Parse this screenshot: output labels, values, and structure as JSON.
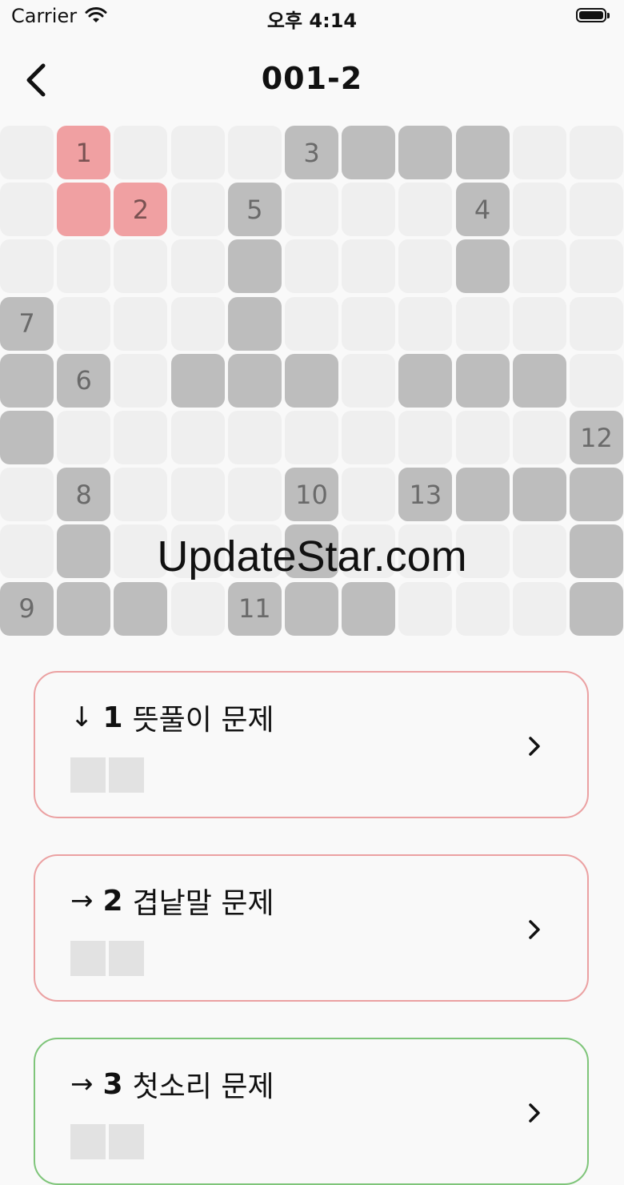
{
  "status_bar": {
    "carrier": "Carrier",
    "time": "오후 4:14"
  },
  "nav": {
    "title": "001-2"
  },
  "grid": {
    "cells": [
      {
        "r": 0,
        "c": 1,
        "state": "selected",
        "label": "1"
      },
      {
        "r": 0,
        "c": 5,
        "state": "filled",
        "label": "3"
      },
      {
        "r": 0,
        "c": 6,
        "state": "filled",
        "label": ""
      },
      {
        "r": 0,
        "c": 7,
        "state": "filled",
        "label": ""
      },
      {
        "r": 0,
        "c": 8,
        "state": "filled",
        "label": ""
      },
      {
        "r": 1,
        "c": 1,
        "state": "selected",
        "label": ""
      },
      {
        "r": 1,
        "c": 2,
        "state": "selected",
        "label": "2"
      },
      {
        "r": 1,
        "c": 4,
        "state": "filled",
        "label": "5"
      },
      {
        "r": 1,
        "c": 8,
        "state": "filled",
        "label": "4"
      },
      {
        "r": 2,
        "c": 4,
        "state": "filled",
        "label": ""
      },
      {
        "r": 2,
        "c": 8,
        "state": "filled",
        "label": ""
      },
      {
        "r": 3,
        "c": 0,
        "state": "filled",
        "label": "7"
      },
      {
        "r": 3,
        "c": 4,
        "state": "filled",
        "label": ""
      },
      {
        "r": 4,
        "c": 0,
        "state": "filled",
        "label": ""
      },
      {
        "r": 4,
        "c": 1,
        "state": "filled",
        "label": "6"
      },
      {
        "r": 4,
        "c": 3,
        "state": "filled",
        "label": ""
      },
      {
        "r": 4,
        "c": 4,
        "state": "filled",
        "label": ""
      },
      {
        "r": 4,
        "c": 5,
        "state": "filled",
        "label": ""
      },
      {
        "r": 4,
        "c": 7,
        "state": "filled",
        "label": ""
      },
      {
        "r": 4,
        "c": 8,
        "state": "filled",
        "label": ""
      },
      {
        "r": 4,
        "c": 9,
        "state": "filled",
        "label": ""
      },
      {
        "r": 5,
        "c": 0,
        "state": "filled",
        "label": ""
      },
      {
        "r": 5,
        "c": 10,
        "state": "filled",
        "label": "12"
      },
      {
        "r": 6,
        "c": 1,
        "state": "filled",
        "label": "8"
      },
      {
        "r": 6,
        "c": 5,
        "state": "filled",
        "label": "10"
      },
      {
        "r": 6,
        "c": 7,
        "state": "filled",
        "label": "13"
      },
      {
        "r": 6,
        "c": 8,
        "state": "filled",
        "label": ""
      },
      {
        "r": 6,
        "c": 9,
        "state": "filled",
        "label": ""
      },
      {
        "r": 6,
        "c": 10,
        "state": "filled",
        "label": ""
      },
      {
        "r": 7,
        "c": 1,
        "state": "filled",
        "label": ""
      },
      {
        "r": 7,
        "c": 5,
        "state": "filled",
        "label": ""
      },
      {
        "r": 7,
        "c": 10,
        "state": "filled",
        "label": ""
      },
      {
        "r": 8,
        "c": 0,
        "state": "filled",
        "label": "9"
      },
      {
        "r": 8,
        "c": 1,
        "state": "filled",
        "label": ""
      },
      {
        "r": 8,
        "c": 2,
        "state": "filled",
        "label": ""
      },
      {
        "r": 8,
        "c": 4,
        "state": "filled",
        "label": "11"
      },
      {
        "r": 8,
        "c": 5,
        "state": "filled",
        "label": ""
      },
      {
        "r": 8,
        "c": 6,
        "state": "filled",
        "label": ""
      },
      {
        "r": 8,
        "c": 10,
        "state": "filled",
        "label": ""
      }
    ]
  },
  "watermark": "UpdateStar.com",
  "clues": [
    {
      "direction": "↓",
      "number": "1",
      "text": "뜻풀이 문제",
      "boxes": 2,
      "border": "#eba1a2"
    },
    {
      "direction": "→",
      "number": "2",
      "text": "겹낱말 문제",
      "boxes": 2,
      "border": "#eba1a2"
    },
    {
      "direction": "→",
      "number": "3",
      "text": "첫소리 문제",
      "boxes": 2,
      "border": "#7fc57a"
    }
  ],
  "colors": {
    "selected": "#f0a0a2",
    "filled": "#bdbdbd",
    "empty": "#efefef"
  }
}
